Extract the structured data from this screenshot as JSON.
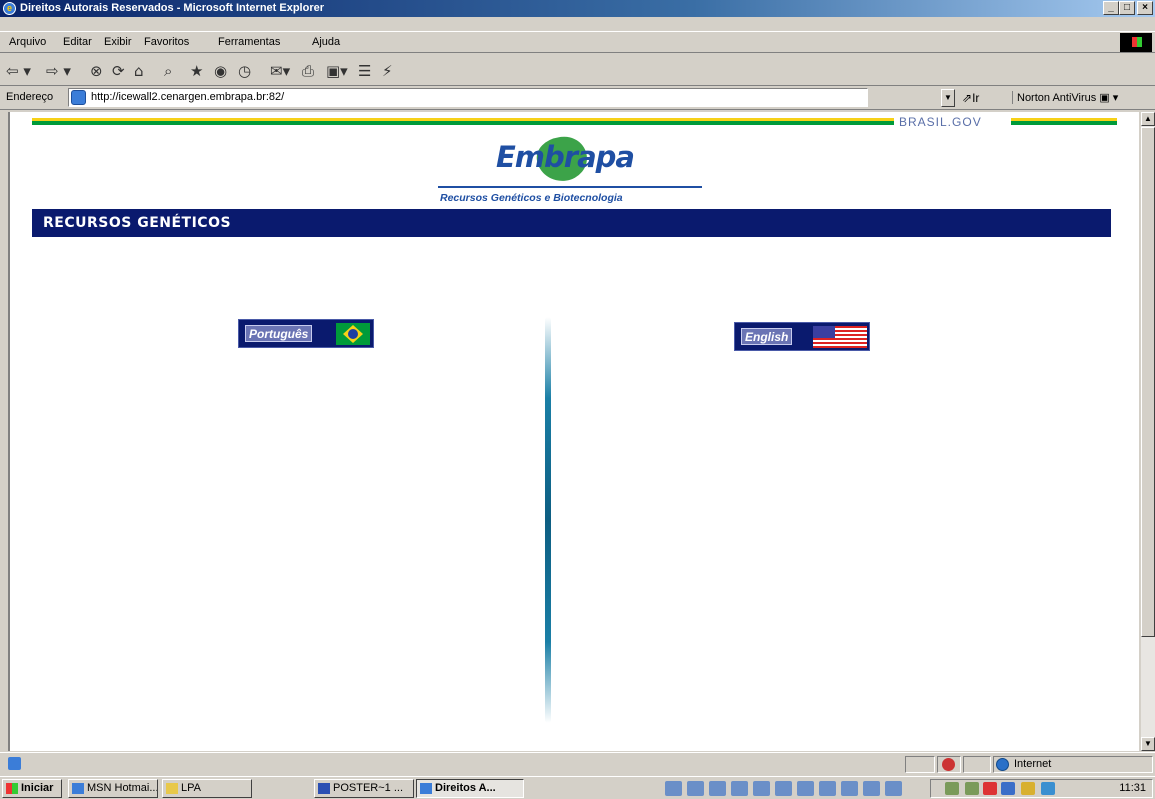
{
  "window": {
    "title": "Direitos Autorais Reservados - Microsoft Internet Explorer",
    "min": "_",
    "max": "□",
    "close": "×"
  },
  "menu": [
    "Arquivo",
    "Editar",
    "Exibir",
    "Favoritos",
    "Ferramentas",
    "Ajuda"
  ],
  "toolbar_icons": [
    "back-icon",
    "forward-icon",
    "stop-icon",
    "refresh-icon",
    "home-icon",
    "search-icon",
    "favorites-icon",
    "media-icon",
    "history-icon",
    "mail-icon",
    "print-icon",
    "edit-icon",
    "discuss-icon",
    "messenger-icon"
  ],
  "address": {
    "label": "Endereço",
    "url": "http://icewall2.cenargen.embrapa.br:82/",
    "go": "Ir",
    "norton": "Norton AntiVirus"
  },
  "page": {
    "gov": "BRASIL.GOV",
    "logo": "Embrapa",
    "logo_sub": "Recursos Genéticos e Biotecnologia",
    "section_title": "RECURSOS GENÉTICOS",
    "lang_pt": "Português",
    "lang_en": "English"
  },
  "status": {
    "zone": "Internet"
  },
  "taskbar": {
    "start": "Iniciar",
    "tasks": [
      "MSN Hotmai...",
      "LPA",
      "POSTER~1 ...",
      "Direitos A..."
    ],
    "clock": "11:31"
  },
  "colors": {
    "section_bar": "#0a1a6e",
    "embrapa_blue": "#1f4fa3",
    "embrapa_green": "#3ca349",
    "gov_yellow": "#f7d117",
    "gov_green": "#009b3a"
  }
}
